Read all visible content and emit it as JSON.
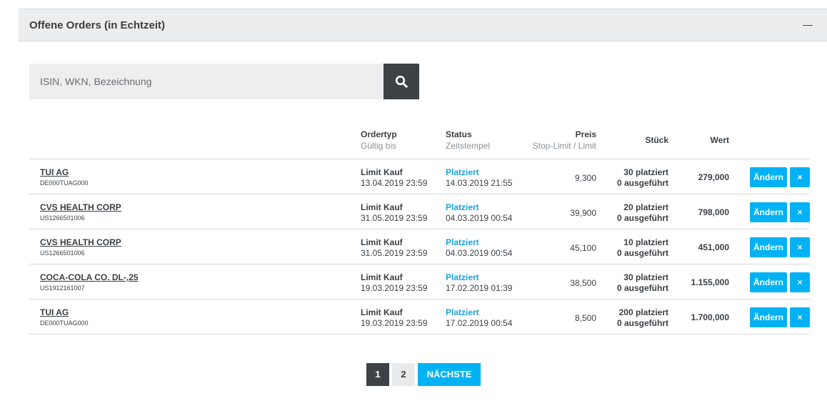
{
  "panel": {
    "title": "Offene Orders (in Echtzeit)"
  },
  "search": {
    "placeholder": "ISIN, WKN, Bezeichnung",
    "value": "",
    "icon": "search-icon"
  },
  "columns": {
    "ordertyp": "Ordertyp",
    "gueltig_bis": "Gültig bis",
    "status": "Status",
    "zeitstempel": "Zeitstempel",
    "preis": "Preis",
    "preis_sub": "Stop-Limit / Limit",
    "stueck": "Stück",
    "wert": "Wert"
  },
  "rows": [
    {
      "name": "TUI AG",
      "isin": "DE000TUAG000",
      "ordertyp": "Limit Kauf",
      "gueltig_bis": "13.04.2019 23:59",
      "status": "Platziert",
      "zeitstempel": "14.03.2019 21:55",
      "preis": "9,300",
      "platziert": "30 platziert",
      "ausgefuehrt": "0 ausgeführt",
      "wert": "279,000",
      "edit_label": "Ändern",
      "delete_label": "×"
    },
    {
      "name": "CVS HEALTH CORP",
      "isin": "US1266501006",
      "ordertyp": "Limit Kauf",
      "gueltig_bis": "31.05.2019 23:59",
      "status": "Platziert",
      "zeitstempel": "04.03.2019 00:54",
      "preis": "39,900",
      "platziert": "20 platziert",
      "ausgefuehrt": "0 ausgeführt",
      "wert": "798,000",
      "edit_label": "Ändern",
      "delete_label": "×"
    },
    {
      "name": "CVS HEALTH CORP",
      "isin": "US1266501006",
      "ordertyp": "Limit Kauf",
      "gueltig_bis": "31.05.2019 23:59",
      "status": "Platziert",
      "zeitstempel": "04.03.2019 00:54",
      "preis": "45,100",
      "platziert": "10 platziert",
      "ausgefuehrt": "0 ausgeführt",
      "wert": "451,000",
      "edit_label": "Ändern",
      "delete_label": "×"
    },
    {
      "name": "COCA-COLA CO. DL-,25",
      "isin": "US1912161007",
      "ordertyp": "Limit Kauf",
      "gueltig_bis": "19.03.2019 23:59",
      "status": "Platziert",
      "zeitstempel": "17.02.2019 01:39",
      "preis": "38,500",
      "platziert": "30 platziert",
      "ausgefuehrt": "0 ausgeführt",
      "wert": "1.155,000",
      "edit_label": "Ändern",
      "delete_label": "×"
    },
    {
      "name": "TUI AG",
      "isin": "DE000TUAG000",
      "ordertyp": "Limit Kauf",
      "gueltig_bis": "19.03.2019 23:59",
      "status": "Platziert",
      "zeitstempel": "17.02.2019 00:54",
      "preis": "8,500",
      "platziert": "200 platziert",
      "ausgefuehrt": "0 ausgeführt",
      "wert": "1.700,000",
      "edit_label": "Ändern",
      "delete_label": "×"
    }
  ],
  "pagination": {
    "pages": [
      "1",
      "2"
    ],
    "current": "1",
    "next_label": "NÄCHSTE"
  },
  "colors": {
    "accent": "#00b2f3",
    "status": "#1aa3e0",
    "dark": "#3d4246",
    "header_bg": "#ebedee"
  }
}
